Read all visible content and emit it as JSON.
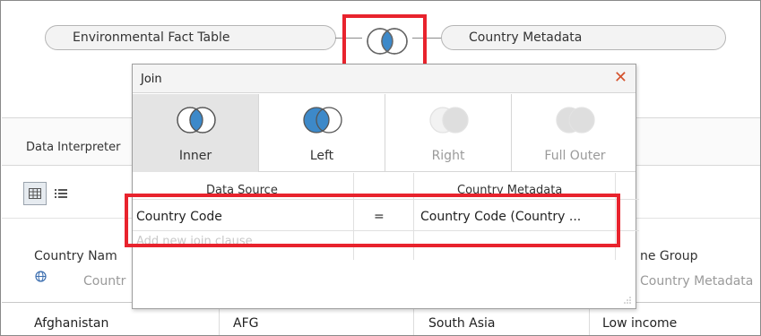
{
  "canvas": {
    "left_table": "Environmental Fact Table",
    "right_table": "Country Metadata"
  },
  "join_dialog": {
    "title": "Join",
    "close_glyph": "✕",
    "join_types": [
      {
        "label": "Inner",
        "enabled": true,
        "selected": true
      },
      {
        "label": "Left",
        "enabled": true,
        "selected": false
      },
      {
        "label": "Right",
        "enabled": false,
        "selected": false
      },
      {
        "label": "Full Outer",
        "enabled": false,
        "selected": false
      }
    ],
    "headers": {
      "left": "Data Source",
      "right": "Country Metadata"
    },
    "clause": {
      "left_field": "Country Code",
      "operator": "=",
      "right_field": "Country Code (Country ..."
    },
    "add_clause_placeholder": "Add new join clause"
  },
  "interpreter": {
    "label": "Data Interpreter"
  },
  "grid": {
    "col1_header": "Country Nam",
    "col1_sub": "Countr",
    "col4_header": "ne Group",
    "col4_sub": "Country Metadata",
    "row": [
      "Afghanistan",
      "AFG",
      "South Asia",
      "Low income"
    ]
  },
  "colors": {
    "venn_blue": "#3d89c9",
    "highlight_red": "#e8232d",
    "close_orange": "#d5532e"
  },
  "icons": [
    "venn-join-icon",
    "grid-view-icon",
    "list-view-icon",
    "globe-icon",
    "close-icon",
    "resize-grip-icon"
  ]
}
